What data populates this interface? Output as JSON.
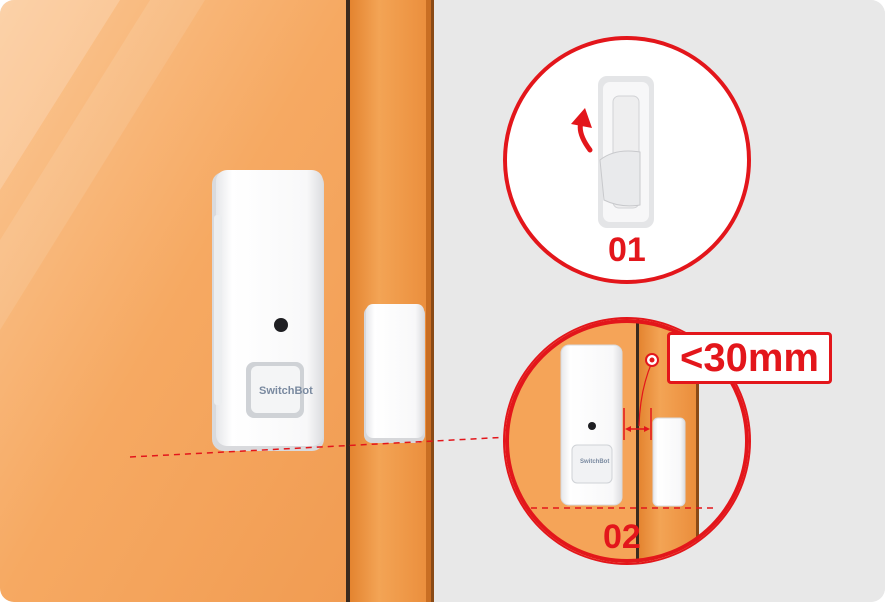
{
  "scene": {
    "brand_name": "SwitchBot",
    "steps": [
      {
        "number": "01",
        "action": "peel-adhesive"
      },
      {
        "number": "02",
        "action": "align-and-mount"
      }
    ],
    "max_gap": "<30mm"
  },
  "colors": {
    "door": "#f6a860",
    "frame": "#ee8f3a",
    "wall": "#e8e8e8",
    "device": "#ffffff",
    "accent": "#e3161b"
  },
  "icons": [
    "peel-arrow-icon",
    "gap-arrow-icon"
  ]
}
